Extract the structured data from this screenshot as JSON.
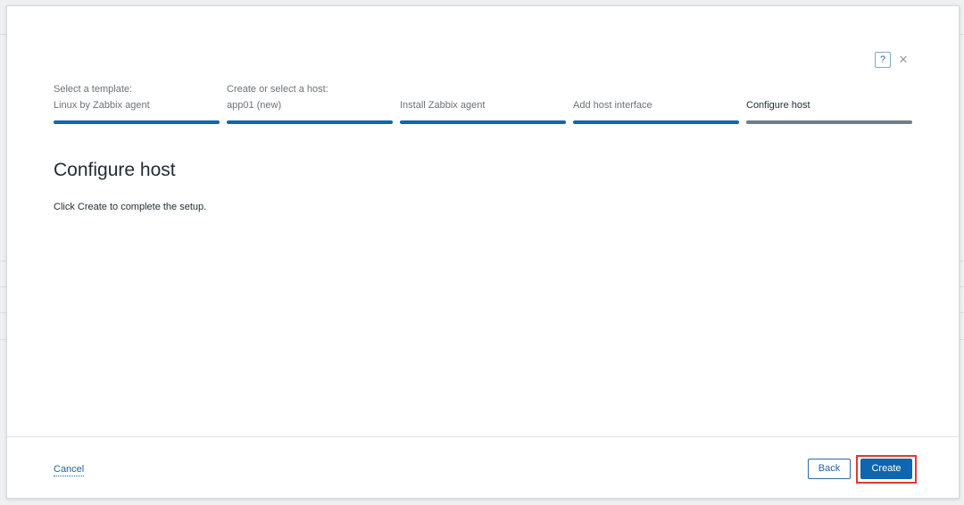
{
  "dialog": {
    "help_label": "?",
    "close_label": "×"
  },
  "steps": [
    {
      "label_top": "Select a template:",
      "label_bottom": "Linux by Zabbix agent"
    },
    {
      "label_top": "Create or select a host:",
      "label_bottom": "app01 (new)"
    },
    {
      "label_top": "",
      "label_bottom": "Install Zabbix agent"
    },
    {
      "label_top": "",
      "label_bottom": "Add host interface"
    },
    {
      "label_top": "",
      "label_bottom": "Configure host"
    }
  ],
  "main": {
    "heading": "Configure host",
    "description": "Click Create to complete the setup."
  },
  "footer": {
    "cancel_label": "Cancel",
    "back_label": "Back",
    "create_label": "Create"
  },
  "colors": {
    "accent": "#0d66b0",
    "current_step": "#6d7e86",
    "highlight": "#e03b2b"
  }
}
